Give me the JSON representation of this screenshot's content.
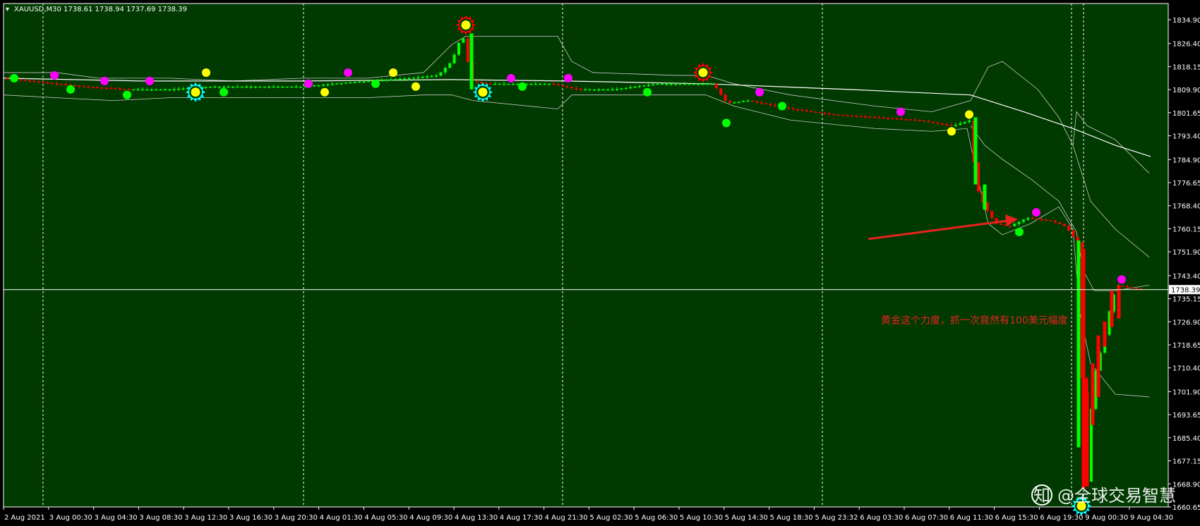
{
  "header": {
    "symbol": "XAUUSD,M30",
    "ohlc": "1738.61 1738.94 1737.69 1738.39"
  },
  "annotation": "黄金这个力度，抓一次竟然有100美元幅度",
  "watermark": {
    "logo": "知",
    "text": "@全球交易智慧"
  },
  "colors": {
    "background": "#003a00",
    "bull": "#00ff00",
    "bear": "#ff0000",
    "band": "#c8c8c8",
    "ma": "#ffffff",
    "arrow": "#e8231f"
  },
  "chart_data": {
    "type": "candlestick",
    "symbol": "XAUUSD",
    "timeframe": "M30",
    "ylim": [
      1660.65,
      1838.5
    ],
    "y_ticks": [
      "1834.90",
      "1826.40",
      "1818.15",
      "1809.90",
      "1801.65",
      "1793.40",
      "1784.90",
      "1776.65",
      "1768.40",
      "1760.15",
      "1751.90",
      "1743.40",
      "1735.15",
      "1726.90",
      "1718.65",
      "1710.40",
      "1701.90",
      "1693.65",
      "1685.40",
      "1677.15",
      "1668.90",
      "1660.65"
    ],
    "current_price": "1738.39",
    "x_labels": [
      "2 Aug 2021",
      "3 Aug 00:30",
      "3 Aug 04:30",
      "3 Aug 08:30",
      "3 Aug 12:30",
      "3 Aug 16:30",
      "3 Aug 20:30",
      "4 Aug 01:30",
      "4 Aug 05:30",
      "4 Aug 09:30",
      "4 Aug 13:30",
      "4 Aug 17:30",
      "4 Aug 21:30",
      "5 Aug 02:30",
      "5 Aug 06:30",
      "5 Aug 10:30",
      "5 Aug 14:30",
      "5 Aug 18:30",
      "5 Aug 23:32",
      "6 Aug 03:30",
      "6 Aug 07:30",
      "6 Aug 11:30",
      "6 Aug 15:30",
      "6 Aug 19:30",
      "9 Aug 00:30",
      "9 Aug 04:30"
    ],
    "key_points": [
      {
        "time": "2 Aug 2021",
        "close": 1814.0
      },
      {
        "time": "4 Aug 13:30",
        "high": 1830.5,
        "low": 1808.0
      },
      {
        "time": "6 Aug 11:30",
        "close": 1799.0
      },
      {
        "time": "6 Aug 15:30",
        "close": 1763.0
      },
      {
        "time": "9 Aug 00:30",
        "low": 1684.0
      },
      {
        "time": "9 Aug 01:30",
        "low": 1666.0
      },
      {
        "time": "9 Aug 04:30",
        "close": 1738.39
      }
    ],
    "grid": "vertical day separators",
    "annotation_arrow": "pointing to 6 Aug 15:30 breakdown level"
  }
}
